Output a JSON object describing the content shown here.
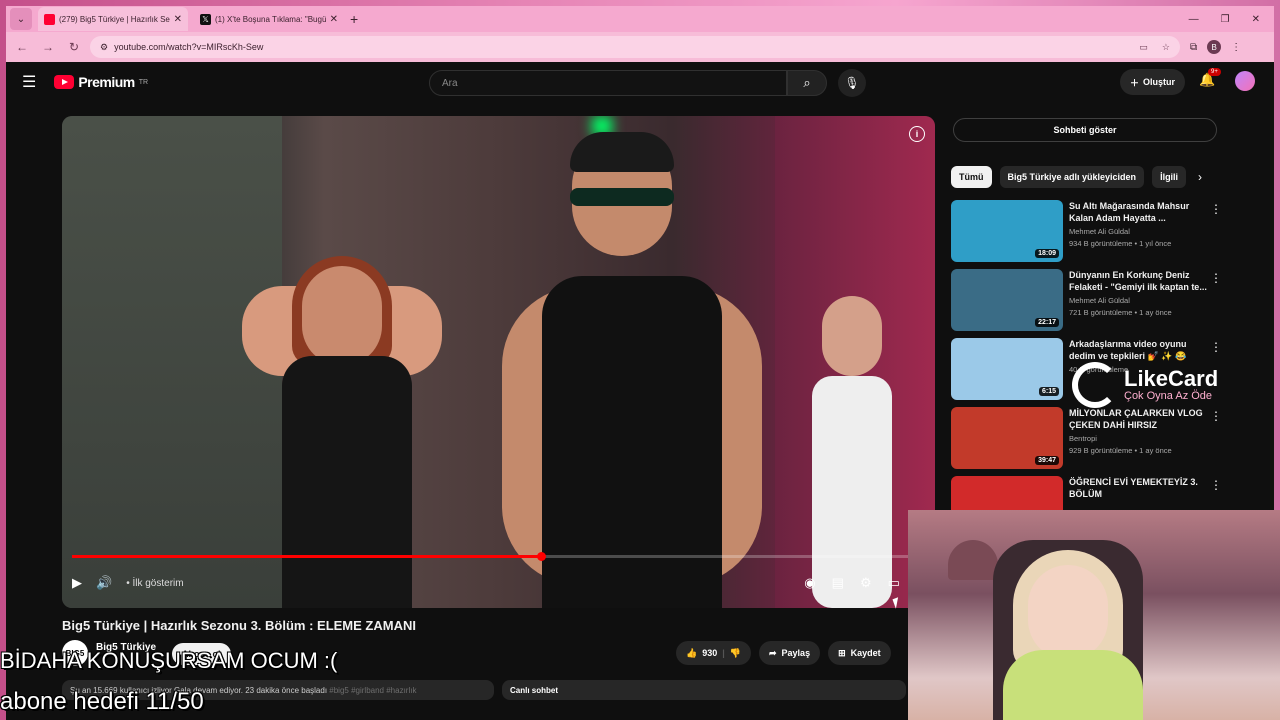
{
  "browser": {
    "tabs": [
      {
        "title": "(279) Big5 Türkiye | Hazırlık Sez",
        "icon": "youtube-icon",
        "active": true
      },
      {
        "title": "(1) X'te Boşuna Tıklama: \"Bugü",
        "icon": "x-icon",
        "active": false
      }
    ],
    "new_tab": "+",
    "url": "youtube.com/watch?v=MIRscKh-Sew",
    "profile_initial": "B"
  },
  "youtube": {
    "logo_text": "Premium",
    "logo_region": "TR",
    "search_placeholder": "Ara",
    "create_label": "Oluştur",
    "notification_count": "9+",
    "accent_color": "#ff0033"
  },
  "player": {
    "progress_fraction": 0.55,
    "chapter_label": "İlk gösterim"
  },
  "video": {
    "title": "Big5 Türkiye | Hazırlık Sezonu 3. Bölüm : ELEME ZAMANI",
    "channel": "Big5 Türkiye",
    "channel_avatar_text": "BIG5",
    "subscribe_label": "Abone ol",
    "like_count": "930",
    "share_label": "Paylaş",
    "save_label": "Kaydet",
    "description_text": "Şu an 15.669 kullanıcı izliyor  Gala devam ediyor. 23 dakika önce başladı",
    "description_tags": "#big5 #girlband #hazırlık",
    "live_chat_label": "Canlı sohbet"
  },
  "sidebar": {
    "chat_toggle": "Sohbeti göster",
    "chips": [
      "Tümü",
      "Big5 Türkiye adlı yükleyiciden",
      "İlgili"
    ],
    "recommendations": [
      {
        "title": "Su Altı Mağarasında Mahsur Kalan Adam Hayatta ...",
        "channel": "Mehmet Ali Güldal",
        "stats": "934 B görüntüleme • 1 yıl önce",
        "duration": "18:09",
        "thumb_color": "#2f9ec7"
      },
      {
        "title": "Dünyanın En Korkunç Deniz Felaketi - \"Gemiyi ilk kaptan te...",
        "channel": "Mehmet Ali Güldal",
        "stats": "721 B görüntüleme • 1 ay önce",
        "duration": "22:17",
        "thumb_color": "#3a6c86"
      },
      {
        "title": "Arkadaşlarıma video oyunu dedim ve tepkileri 💅 ✨ 😂",
        "channel": "",
        "stats": "40 B görüntüleme",
        "duration": "6:15",
        "thumb_color": "#9bc9e8"
      },
      {
        "title": "MİLYONLAR ÇALARKEN VLOG ÇEKEN DAHİ HIRSIZ",
        "channel": "Bentropi",
        "stats": "929 B görüntüleme • 1 ay önce",
        "duration": "39:47",
        "thumb_color": "#c23a2a"
      },
      {
        "title": "ÖĞRENCİ EVİ YEMEKTEYİZ 3. BÖLÜM",
        "channel": "",
        "stats": "",
        "duration": "",
        "thumb_color": "#d22a2a"
      }
    ]
  },
  "overlay": {
    "likecard_title": "LikeCard",
    "likecard_slogan": "Çok Oyna   Az Öde",
    "stream_line1": "BİDAHA KONUŞURSAM OCUM :(",
    "stream_line2": "abone hedefi 11/50"
  }
}
